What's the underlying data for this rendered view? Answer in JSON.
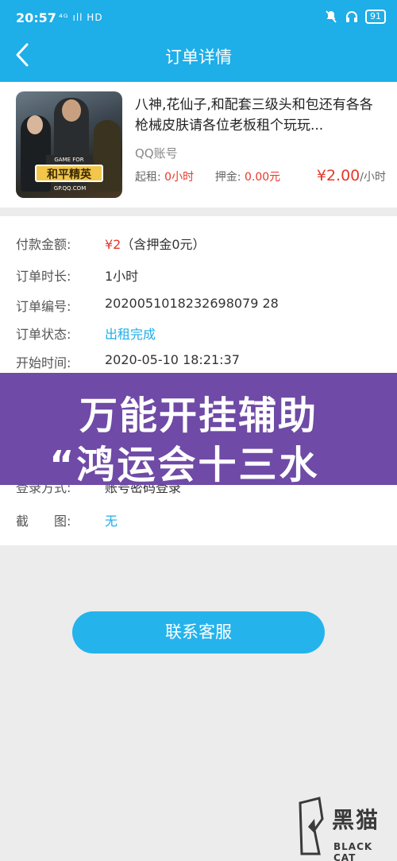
{
  "status_bar": {
    "time": "20:57",
    "network": "⁴ᴳ ıll HD",
    "battery": "91"
  },
  "header": {
    "title": "订单详情"
  },
  "product": {
    "title": "八神,花仙子,和配套三级头和包还有各各枪械皮肤请各位老板租个玩玩...",
    "account_type": "QQ账号",
    "rent_start_label": "起租:",
    "rent_start_value": "0小时",
    "deposit_label": "押金:",
    "deposit_value": "0.00元",
    "price_value": "¥2.00",
    "price_unit": "/小时",
    "thumbnail": {
      "banner": "GAME FOR PEACE",
      "logo": "和平精英",
      "site": "GP.QQ.COM"
    }
  },
  "details": {
    "payment_label": "付款金额:",
    "payment_amount": "¥2",
    "payment_note": "（含押金0元）",
    "duration_label": "订单时长:",
    "duration_value": "1小时",
    "order_no_label": "订单编号:",
    "order_no_value": "2020051018232698079 28",
    "status_label": "订单状态:",
    "status_value": "出租完成",
    "start_label": "开始时间:",
    "start_value": "2020-05-10  18:21:37",
    "login_label": "登录方式:",
    "login_value": "账号密码登录",
    "screenshot_label": "截　　图:",
    "screenshot_value": "无"
  },
  "overlay": {
    "line1": "万能开挂辅助",
    "line2": "“鸿运会十三水"
  },
  "contact_button": "联系客服",
  "watermark": {
    "cn": "黑猫",
    "en": "BLACK CAT"
  }
}
